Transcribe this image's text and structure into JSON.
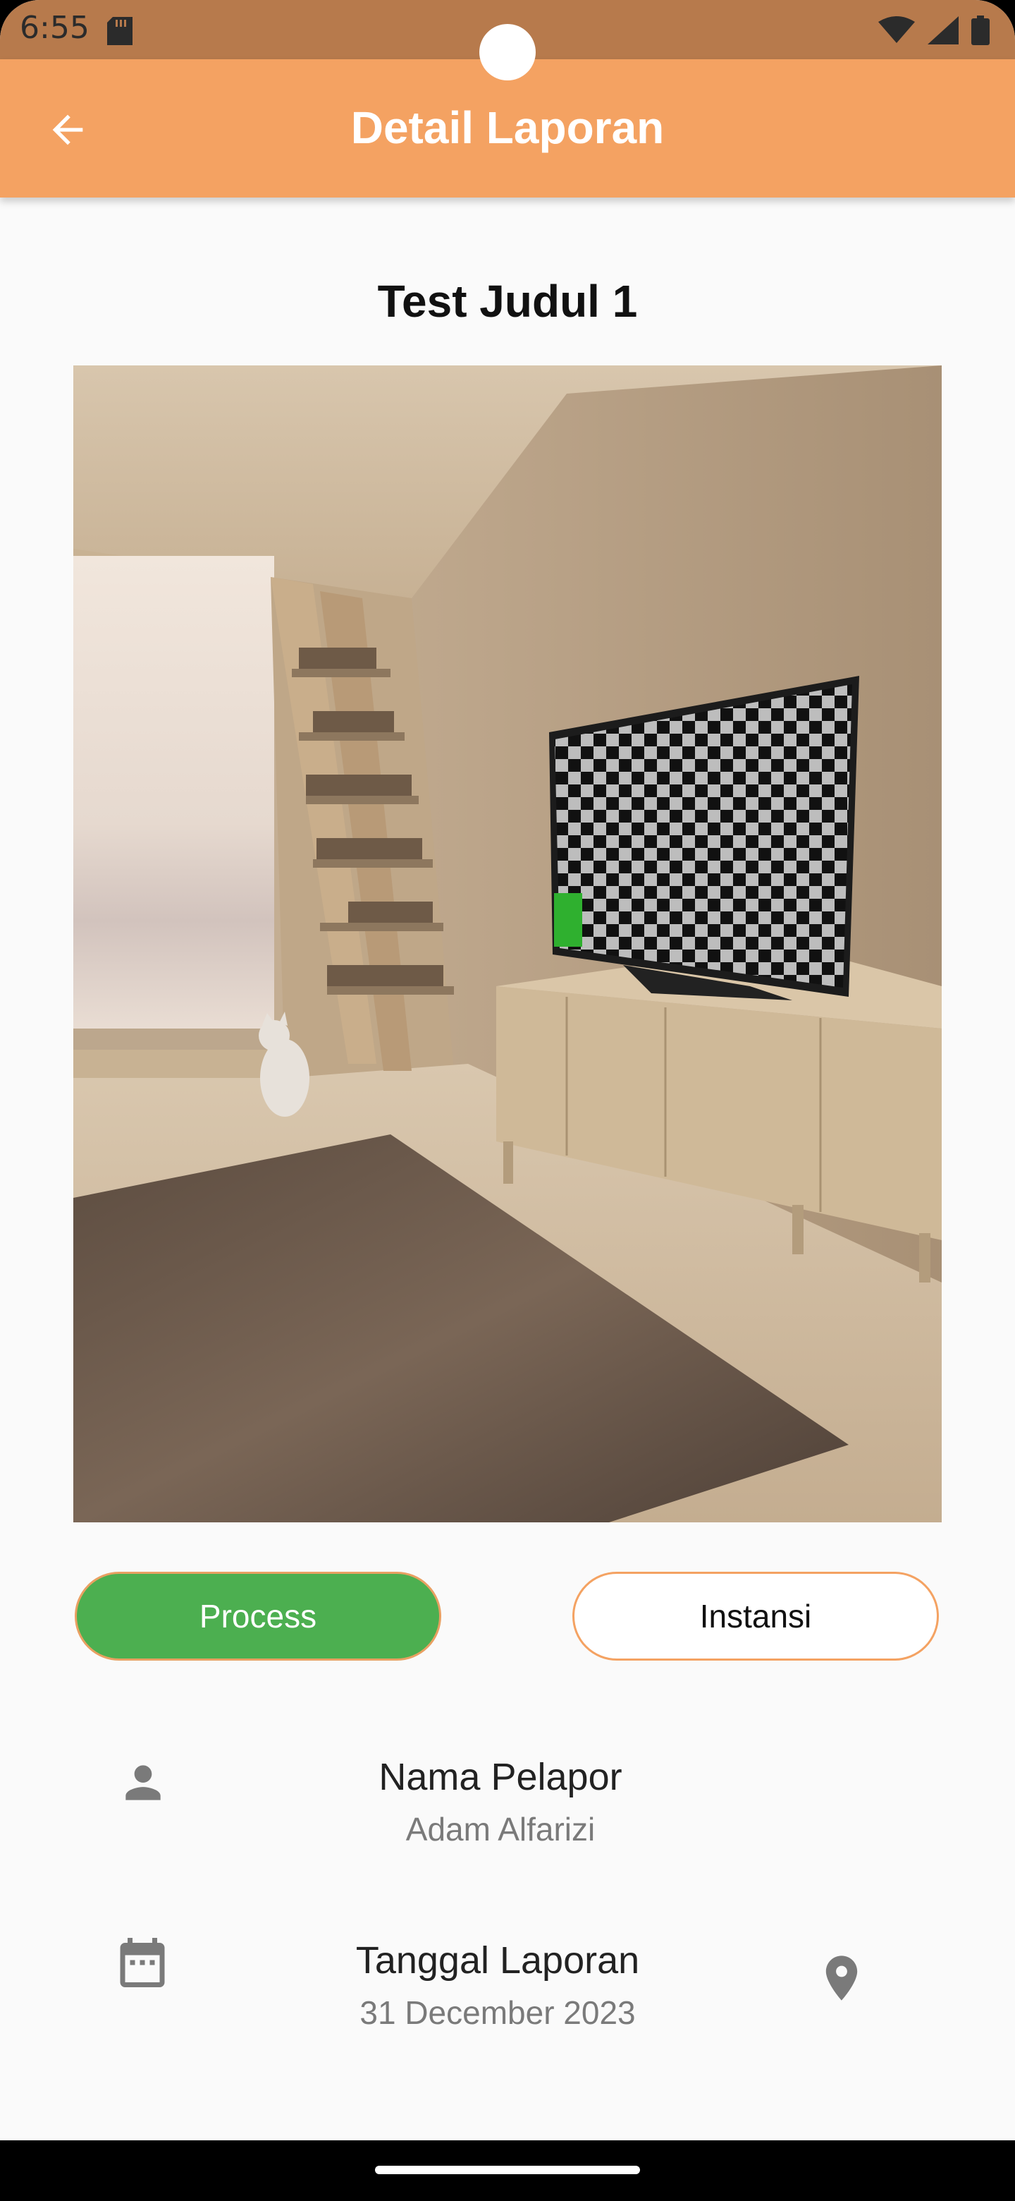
{
  "status_bar": {
    "time": "6:55",
    "icons": [
      "sd-card-icon",
      "wifi-icon",
      "signal-icon",
      "battery-icon"
    ]
  },
  "app_bar": {
    "title": "Detail Laporan",
    "back_icon": "arrow-back-icon",
    "background": "#F4A262"
  },
  "report": {
    "title": "Test Judul 1",
    "image": "report-photo"
  },
  "actions": {
    "process_label": "Process",
    "instansi_label": "Instansi",
    "process_color": "#4CAF50",
    "accent_color": "#F4A262"
  },
  "details": {
    "reporter": {
      "label": "Nama Pelapor",
      "value": "Adam Alfarizi",
      "icon": "person-icon"
    },
    "date": {
      "label": "Tanggal Laporan",
      "value": "31 December 2023",
      "icon": "calendar-icon"
    },
    "location_icon": "location-pin-icon"
  }
}
